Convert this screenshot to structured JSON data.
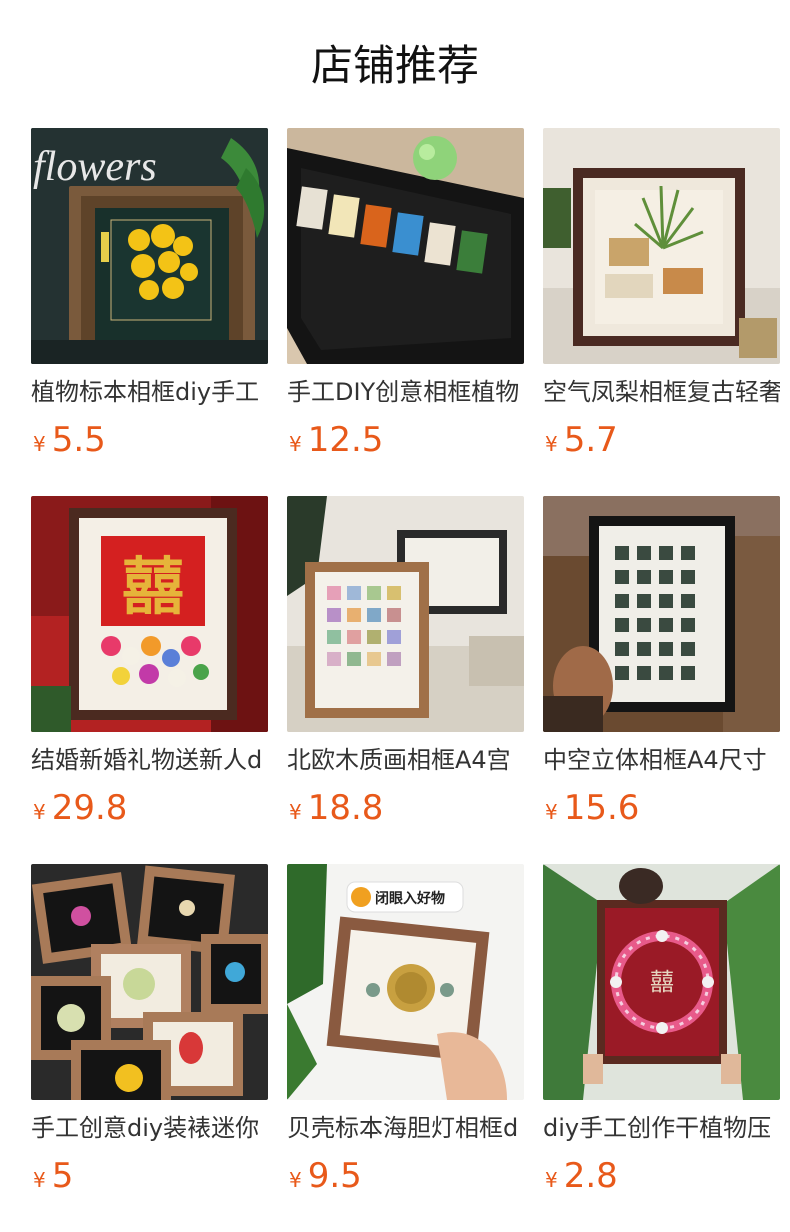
{
  "section": {
    "title": "店铺推荐"
  },
  "currency": "¥",
  "products": [
    {
      "name": "植物标本相框diy手工",
      "price": "5.5",
      "image_icon": "flower-frame-image",
      "image_text": "flowers"
    },
    {
      "name": "手工DIY创意相框植物",
      "price": "12.5",
      "image_icon": "specimen-strip-frame-image"
    },
    {
      "name": "空气凤梨相框复古轻奢",
      "price": "5.7",
      "image_icon": "air-plant-frame-image"
    },
    {
      "name": "结婚新婚礼物送新人d",
      "price": "29.8",
      "image_icon": "wedding-frame-image",
      "image_text": "囍"
    },
    {
      "name": "北欧木质画相框A4宫",
      "price": "18.8",
      "image_icon": "specimen-grid-frame-image"
    },
    {
      "name": "中空立体相框A4尺寸",
      "price": "15.6",
      "image_icon": "shadow-box-frame-image"
    },
    {
      "name": "手工创意diy装裱迷你",
      "price": "5",
      "image_icon": "mini-frames-image"
    },
    {
      "name": "贝壳标本海胆灯相框d",
      "price": "9.5",
      "image_icon": "sea-urchin-frame-image",
      "image_text": "闭眼入好物"
    },
    {
      "name": "diy手工创作干植物压",
      "price": "2.8",
      "image_icon": "flower-wreath-frame-image",
      "image_text": "囍"
    }
  ]
}
